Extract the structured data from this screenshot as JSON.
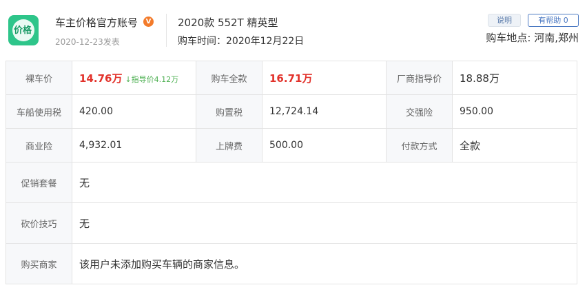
{
  "header": {
    "account_name": "车主价格官方账号",
    "verified_badge": "V",
    "post_date": "2020-12-23发表",
    "model": "2020款 552T 精英型",
    "buy_time": "购车时间：2020年12月22日",
    "explain_button": "说明",
    "helpful_button": "有帮助 0",
    "location": "购车地点: 河南,郑州"
  },
  "logo": {
    "icon_name": "price-tag-logo",
    "text": "价格",
    "color": "#2ec58a"
  },
  "table": {
    "rows": [
      [
        {
          "label": "裸车价",
          "value": "14.76万",
          "hint": "↓指导价4.12万",
          "accent": "#e2322b"
        },
        {
          "label": "购车全款",
          "value": "16.71万",
          "accent": "#e2322b"
        },
        {
          "label": "厂商指导价",
          "value": "18.88万"
        }
      ],
      [
        {
          "label": "车船使用税",
          "value": "420.00"
        },
        {
          "label": "购置税",
          "value": "12,724.14"
        },
        {
          "label": "交强险",
          "value": "950.00"
        }
      ],
      [
        {
          "label": "商业险",
          "value": "4,932.01"
        },
        {
          "label": "上牌费",
          "value": "500.00"
        },
        {
          "label": "付款方式",
          "value": "全款"
        }
      ]
    ],
    "wide_rows": [
      {
        "label": "促销套餐",
        "value": "无"
      },
      {
        "label": "砍价技巧",
        "value": "无"
      },
      {
        "label": "购买商家",
        "value": "该用户未添加购买车辆的商家信息。"
      }
    ]
  }
}
